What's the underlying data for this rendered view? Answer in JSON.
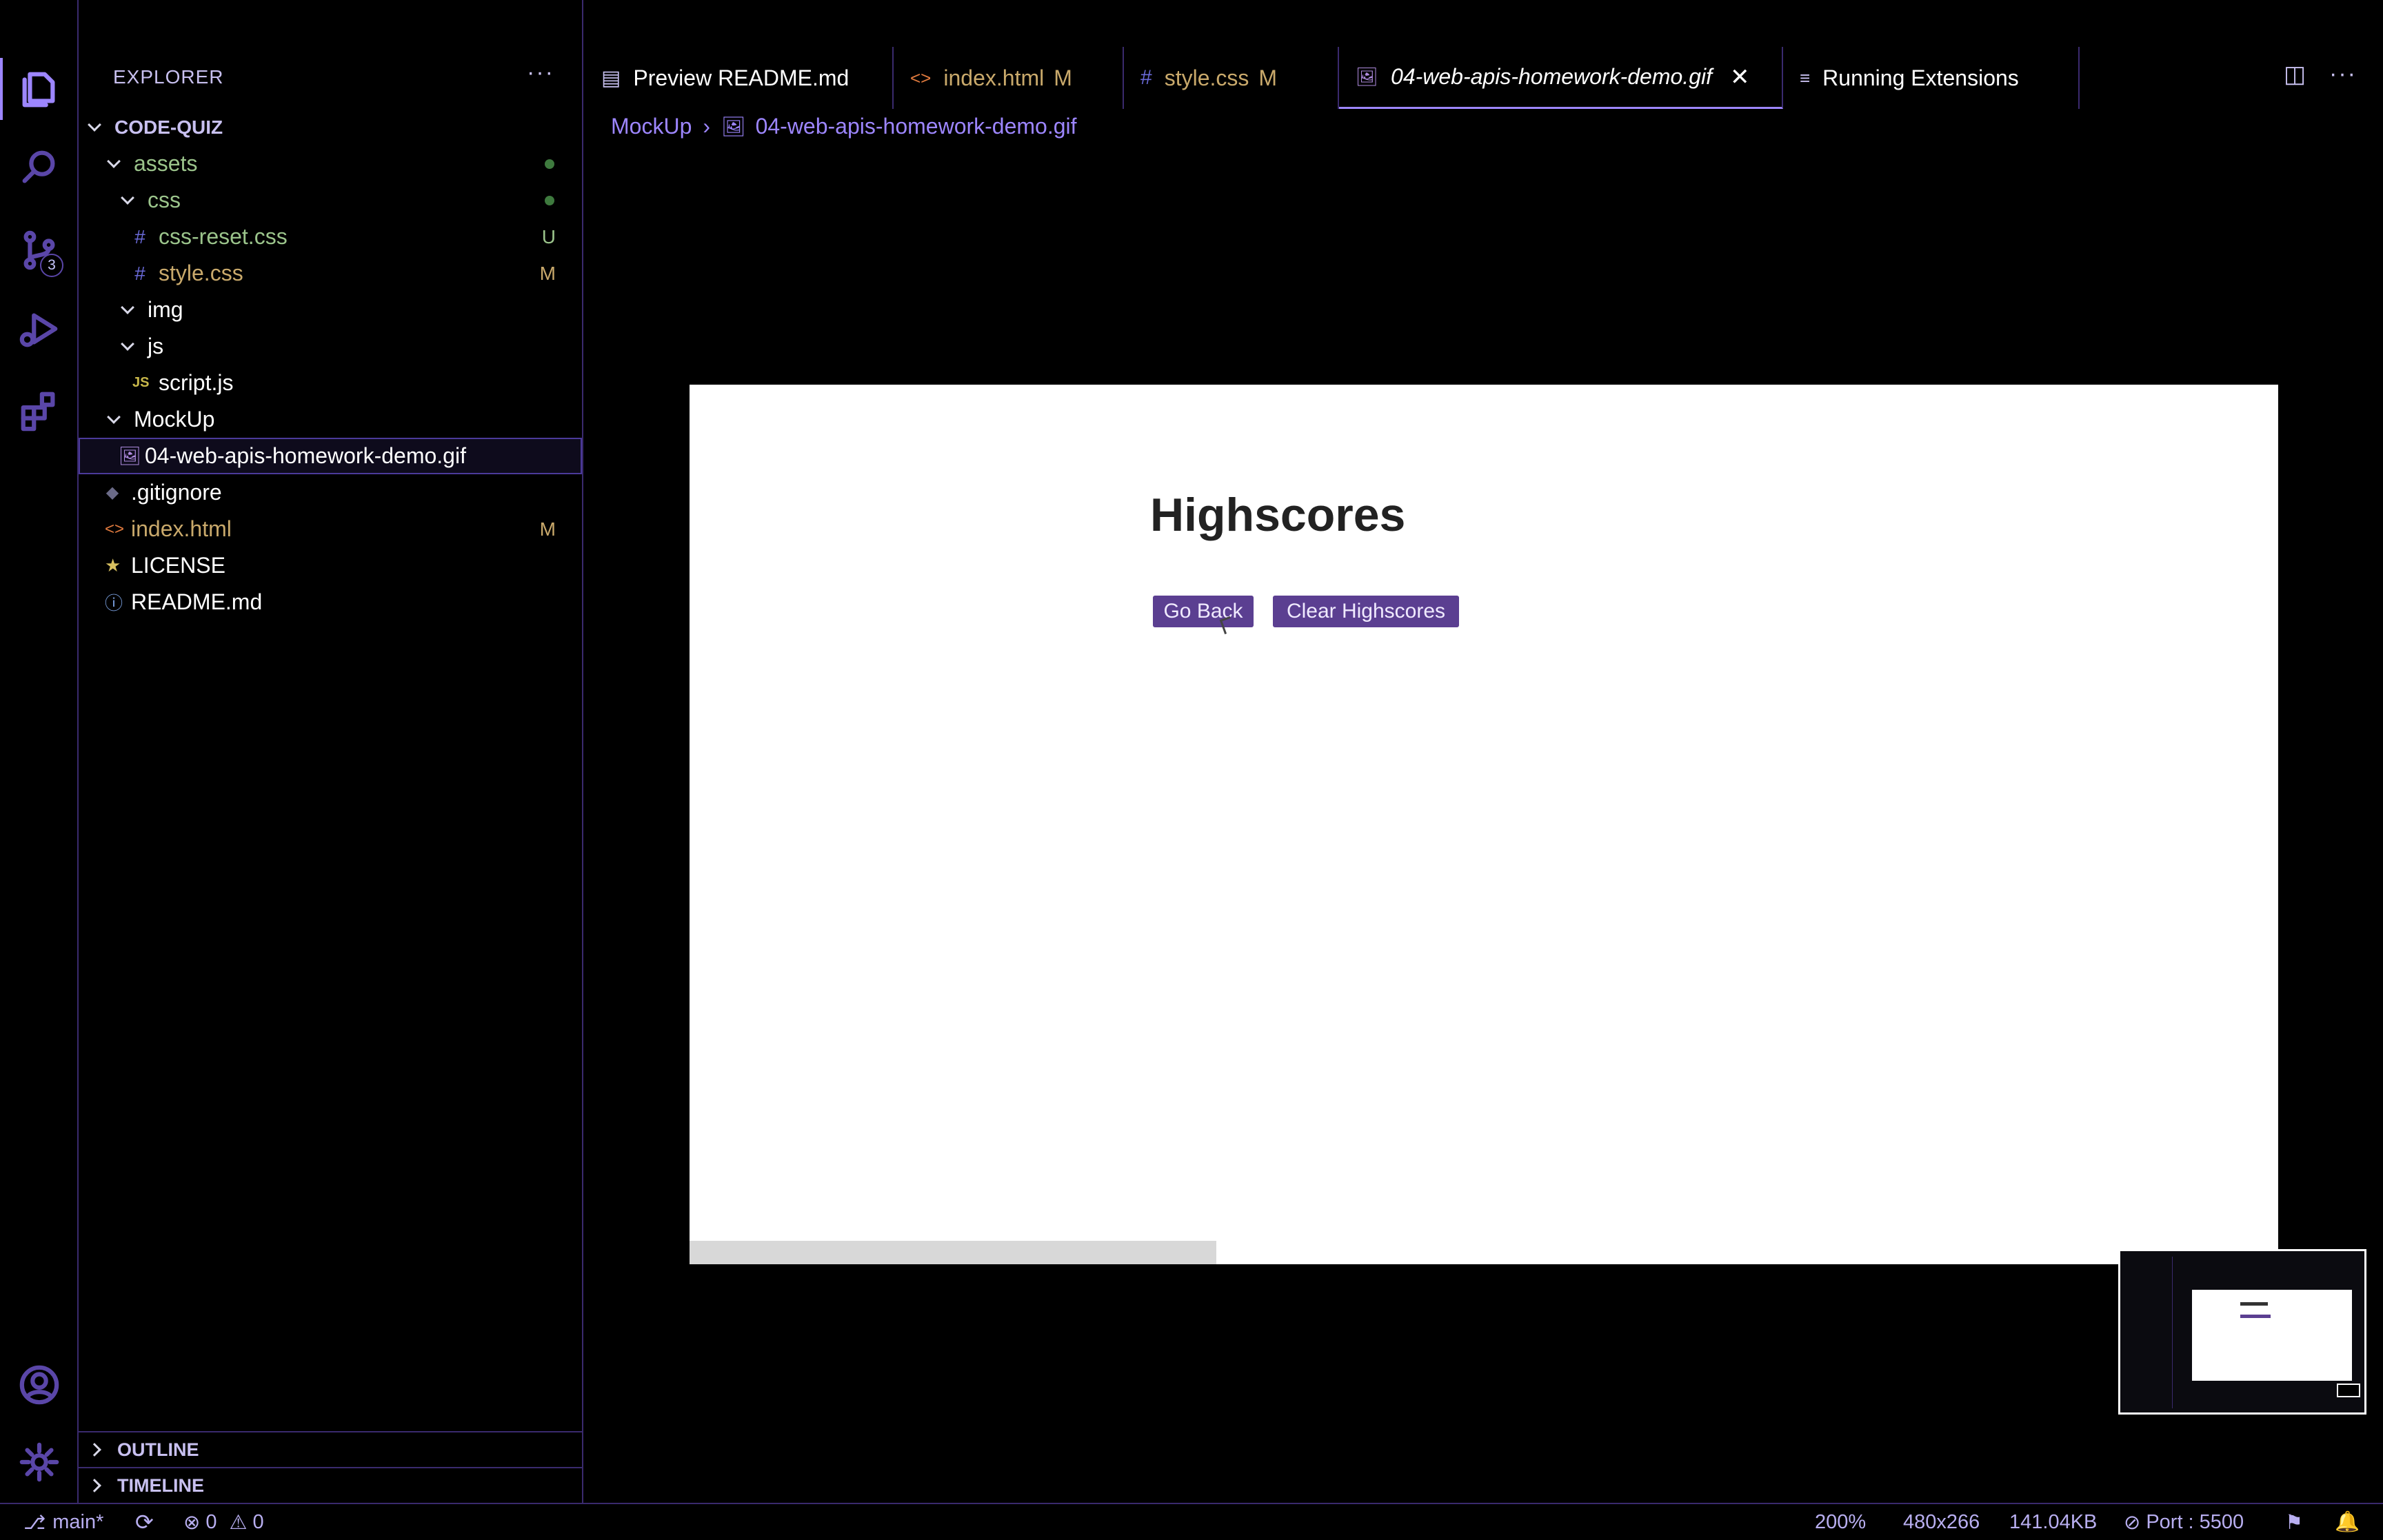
{
  "activity": {
    "source_control_badge": "3"
  },
  "sidebar": {
    "title": "EXPLORER",
    "more": "···",
    "root": "CODE-QUIZ",
    "items": [
      {
        "label": "assets",
        "icon": "folder",
        "decoration": ""
      },
      {
        "label": "css",
        "icon": "folder",
        "decoration": ""
      },
      {
        "label": "css-reset.css",
        "icon": "#",
        "decoration": "U"
      },
      {
        "label": "style.css",
        "icon": "#",
        "decoration": "M"
      },
      {
        "label": "img",
        "icon": "folder",
        "decoration": ""
      },
      {
        "label": "js",
        "icon": "folder",
        "decoration": ""
      },
      {
        "label": "script.js",
        "icon": "JS",
        "decoration": ""
      },
      {
        "label": "MockUp",
        "icon": "folder",
        "decoration": ""
      },
      {
        "label": "04-web-apis-homework-demo.gif",
        "icon": "image",
        "decoration": ""
      },
      {
        "label": ".gitignore",
        "icon": "diamond",
        "decoration": ""
      },
      {
        "label": "index.html",
        "icon": "<>",
        "decoration": "M"
      },
      {
        "label": "LICENSE",
        "icon": "license",
        "decoration": ""
      },
      {
        "label": "README.md",
        "icon": "info",
        "decoration": ""
      }
    ],
    "sections": {
      "outline": "OUTLINE",
      "timeline": "TIMELINE"
    }
  },
  "tabs": [
    {
      "label": "Preview README.md",
      "icon": "preview",
      "modified": ""
    },
    {
      "label": "index.html",
      "icon": "<>",
      "modified": "M"
    },
    {
      "label": "style.css",
      "icon": "#",
      "modified": "M"
    },
    {
      "label": "04-web-apis-homework-demo.gif",
      "icon": "image",
      "modified": ""
    },
    {
      "label": "Running Extensions",
      "icon": "list",
      "modified": ""
    }
  ],
  "breadcrumb": {
    "folder": "MockUp",
    "file": "04-web-apis-homework-demo.gif"
  },
  "preview": {
    "title": "Highscores",
    "go_back": "Go Back",
    "clear": "Clear Highscores"
  },
  "status": {
    "branch": "main*",
    "errors": "0",
    "warnings": "0",
    "zoom": "200%",
    "dimensions": "480x266",
    "size": "141.04KB",
    "port": "Port : 5500"
  },
  "colors": {
    "accent": "#9d86ff",
    "border": "#3a2a6e",
    "untracked": "#9bc48b",
    "modified": "#c9a96b",
    "button": "#5b3f91"
  }
}
